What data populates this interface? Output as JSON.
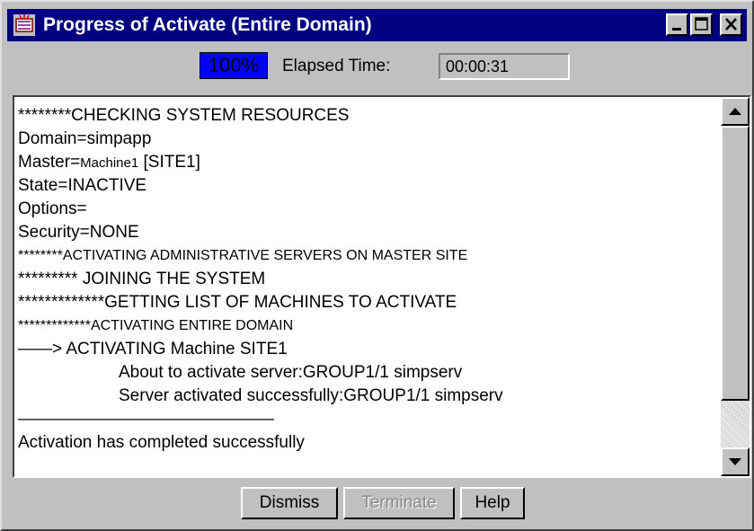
{
  "window": {
    "title": "Progress of Activate (Entire Domain)",
    "title_bar_color": "#000080",
    "icons": [
      "app-icon",
      "minimize-icon",
      "maximize-icon",
      "close-icon"
    ]
  },
  "progress": {
    "label": "100%",
    "value": 1.0,
    "color": "#0000ff"
  },
  "elapsed": {
    "label": "Elapsed Time:",
    "value": "00:00:31"
  },
  "log": {
    "lines": [
      "********CHECKING SYSTEM RESOURCES",
      "Domain=simpapp",
      "Master=",
      "Machine1",
      " [SITE1]",
      "State=INACTIVE",
      "Options=",
      "Security=NONE",
      "********ACTIVATING ADMINISTRATIVE SERVERS ON MASTER SITE",
      "********* JOINING THE SYSTEM",
      "*************GETTING LIST OF MACHINES TO ACTIVATE",
      "*************ACTIVATING ENTIRE DOMAIN",
      "——> ACTIVATING Machine SITE1",
      "About to activate server:GROUP1/1  simpserv",
      "Server activated successfully:GROUP1/1  simpserv",
      "———————————————",
      "Activation has completed successfully"
    ]
  },
  "buttons": {
    "dismiss": "Dismiss",
    "terminate": "Terminate",
    "help": "Help"
  }
}
